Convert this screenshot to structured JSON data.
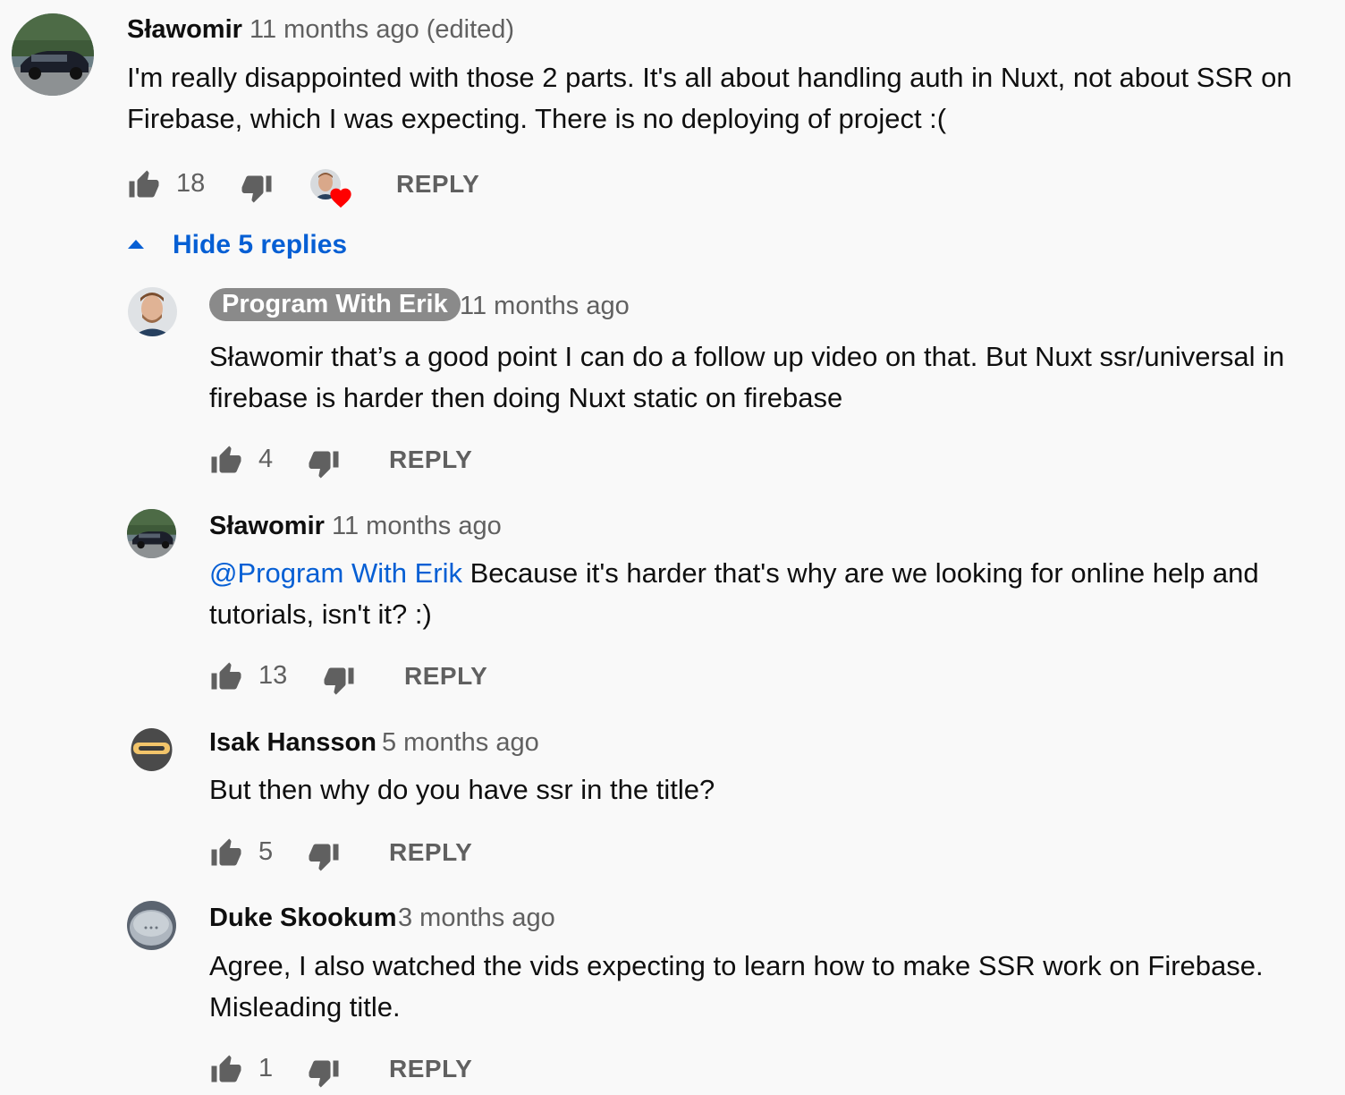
{
  "thread": {
    "top": {
      "author": "Sławomir",
      "time": "11 months ago (edited)",
      "text": "I'm really disappointed with those 2 parts. It's all about handling auth in Nuxt, not about SSR on Firebase, which I was expecting. There is no deploying of project :(",
      "likes": "18",
      "reply_label": "REPLY"
    },
    "toggle_label": "Hide 5 replies",
    "replies": [
      {
        "author": "Program With Erik",
        "time": "11 months ago",
        "text": "Sławomir that’s a good point I can do a follow up video on that. But Nuxt ssr/universal in firebase is harder then doing Nuxt static on firebase",
        "likes": "4",
        "reply_label": "REPLY"
      },
      {
        "author": "Sławomir",
        "time": "11 months ago",
        "mention": "@Program With Erik",
        "text": " Because it's harder that's why are we looking for online help and tutorials, isn't it? :)",
        "likes": "13",
        "reply_label": "REPLY"
      },
      {
        "author": "Isak Hansson",
        "time": "5 months ago",
        "text": "But then why do you have ssr in the title?",
        "likes": "5",
        "reply_label": "REPLY"
      },
      {
        "author": "Duke Skookum",
        "time": "3 months ago",
        "text": "Agree, I also watched the vids expecting to learn how to make SSR work on Firebase. Misleading title.",
        "likes": "1",
        "reply_label": "REPLY"
      }
    ]
  },
  "colors": {
    "background": "#f9f9f9",
    "link": "#065fd4",
    "secondary_text": "#606060",
    "heart": "#ff0000",
    "creator_chip": "#8a8a8a"
  },
  "icons": {
    "like": "thumbs-up-icon",
    "dislike": "thumbs-down-icon",
    "hearted": "creator-heart-icon",
    "collapse": "caret-up-icon"
  }
}
